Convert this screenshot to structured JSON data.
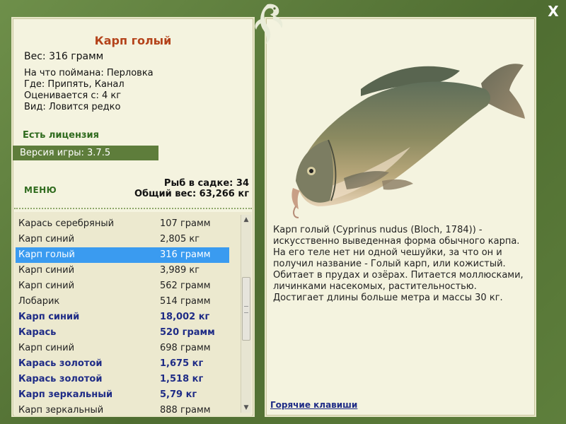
{
  "window": {
    "close_label": "X"
  },
  "fish": {
    "title": "Карп голый",
    "weight": "Вес: 316 грамм",
    "caught_with": "На что поймана: Перловка",
    "location": "Где: Припять, Канал",
    "valued_from": "Оценивается с: 4 кг",
    "kind": "Вид: Ловится редко"
  },
  "license": "Есть лицензия",
  "version": "Версия игры: 3.7.5",
  "menu_label": "МЕНЮ",
  "stats": {
    "fish_in_net": "Рыб в садке: 34",
    "total_weight": "Общий вес: 63,266 кг"
  },
  "fish_list": [
    {
      "name": "Карась серебряный",
      "weight": "107 грамм",
      "bold": false,
      "selected": false
    },
    {
      "name": "Карп синий",
      "weight": "2,805 кг",
      "bold": false,
      "selected": false
    },
    {
      "name": "Карп голый",
      "weight": "316 грамм",
      "bold": false,
      "selected": true
    },
    {
      "name": "Карп синий",
      "weight": "3,989 кг",
      "bold": false,
      "selected": false
    },
    {
      "name": "Карп синий",
      "weight": "562 грамм",
      "bold": false,
      "selected": false
    },
    {
      "name": "Лобарик",
      "weight": "514 грамм",
      "bold": false,
      "selected": false
    },
    {
      "name": "Карп синий",
      "weight": "18,002 кг",
      "bold": true,
      "selected": false
    },
    {
      "name": "Карась",
      "weight": "520 грамм",
      "bold": true,
      "selected": false
    },
    {
      "name": "Карп синий",
      "weight": "698 грамм",
      "bold": false,
      "selected": false
    },
    {
      "name": "Карась золотой",
      "weight": "1,675 кг",
      "bold": true,
      "selected": false
    },
    {
      "name": "Карась золотой",
      "weight": "1,518 кг",
      "bold": true,
      "selected": false
    },
    {
      "name": "Карп зеркальный",
      "weight": "5,79 кг",
      "bold": true,
      "selected": false
    },
    {
      "name": "Карп зеркальный",
      "weight": "888 грамм",
      "bold": false,
      "selected": false
    }
  ],
  "description": "Карп голый (Cyprinus nudus (Bloch, 1784)) - искусственно выведенная форма обычного карпа. На его теле нет ни одной чешуйки, за что он и получил название - Голый карп, или кожистый. Обитает в прудах и озёрах. Питается моллюсками, личинками насекомых, растительностью. Достигает длины больше метра и массы 30 кг.",
  "hotkeys_label": "Горячие клавиши",
  "colors": {
    "frame": "#5b7a3a",
    "panel": "#f4f3df",
    "title": "#b4431b",
    "highlight": "#3a9bf0",
    "bold_row": "#1f2c86",
    "license": "#2f6b1e"
  },
  "icons": {
    "logo": "fish-logo-icon",
    "close": "close-icon"
  }
}
